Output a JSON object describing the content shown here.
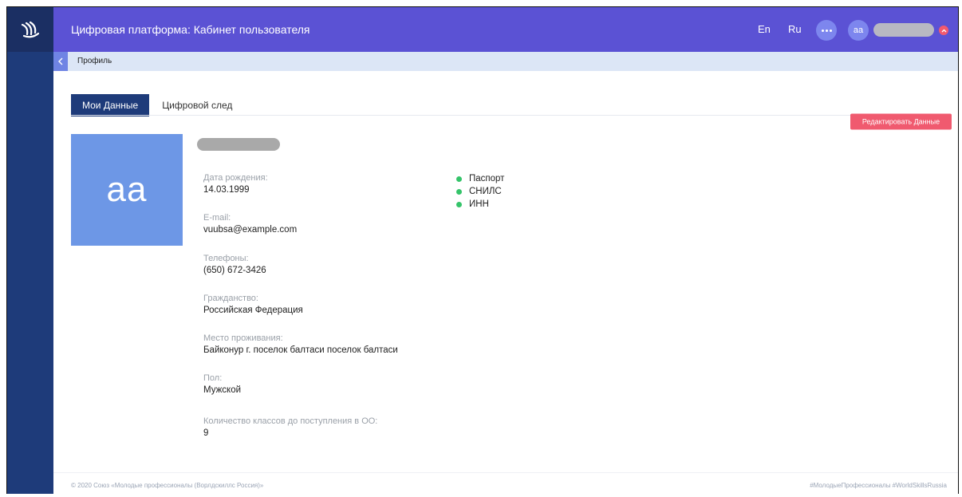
{
  "header": {
    "title": "Цифровая платформа: Кабинет пользователя",
    "lang_en": "En",
    "lang_ru": "Ru",
    "user_initials": "aa"
  },
  "breadcrumb": {
    "current": "Профиль"
  },
  "tabs": [
    {
      "label": "Мои Данные",
      "active": true
    },
    {
      "label": "Цифровой след",
      "active": false
    }
  ],
  "actions": {
    "edit_label": "Редактировать Данные"
  },
  "profile": {
    "avatar_initials": "aa",
    "fields": [
      {
        "label": "Дата рождения:",
        "value": "14.03.1999"
      },
      {
        "label": "E-mail:",
        "value": "vuubsa@example.com"
      },
      {
        "label": "Телефоны:",
        "value": "(650) 672-3426"
      },
      {
        "label": "Гражданство:",
        "value": "Российская Федерация"
      },
      {
        "label": "Место проживания:",
        "value": "Байконур г. поселок балтаси поселок балтаси"
      },
      {
        "label": "Пол:",
        "value": "Мужской"
      },
      {
        "label": "Количество классов до поступления в ОО:",
        "value": "9"
      }
    ],
    "documents": [
      "Паспорт",
      "СНИЛС",
      "ИНН"
    ]
  },
  "footer": {
    "copyright": "© 2020 Союз «Молодые профессионалы (Ворлдскиллс Россия)»",
    "hashtags": "#МолодыеПрофессионалы  #WorldSkillsRussia"
  },
  "colors": {
    "sidebar": "#1e3b7a",
    "topbar": "#5b52d4",
    "accent_red": "#f05a6f",
    "avatar_bg": "#6d97e6",
    "status_green": "#35c46a"
  }
}
